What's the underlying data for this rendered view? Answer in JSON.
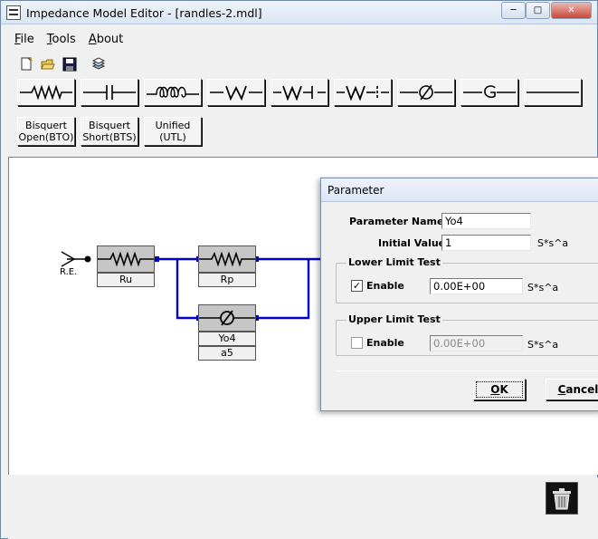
{
  "window": {
    "title": "Impedance Model Editor - [randles-2.mdl]",
    "controls": {
      "minimize": "─",
      "maximize": "□",
      "close": "✕"
    }
  },
  "menu": {
    "file": "File",
    "tools": "Tools",
    "about": "About"
  },
  "special_buttons": [
    {
      "line1": "Bisquert",
      "line2": "Open(BTO)"
    },
    {
      "line1": "Bisquert",
      "line2": "Short(BTS)"
    },
    {
      "line1": "Unified",
      "line2": "(UTL)"
    }
  ],
  "circuit": {
    "input_label": "R.E.",
    "components": [
      {
        "name": "Ru"
      },
      {
        "name": "Rp"
      },
      {
        "name": "Yo4",
        "extra": "a5"
      }
    ],
    "wire_color": "#0000c8"
  },
  "dialog": {
    "title": "Parameter",
    "param_name_label": "Parameter Name:",
    "param_name_value": "Yo4",
    "initial_value_label": "Initial Value:",
    "initial_value": "1",
    "units": "S*s^a",
    "lower": {
      "title": "Lower Limit Test",
      "enable_label": "Enable",
      "checked": true,
      "value": "0.00E+00",
      "units": "S*s^a"
    },
    "upper": {
      "title": "Upper Limit Test",
      "enable_label": "Enable",
      "checked": false,
      "value": "0.00E+00",
      "units": "S*s^a"
    },
    "ok_label": "OK",
    "cancel_label": "Cancel"
  }
}
